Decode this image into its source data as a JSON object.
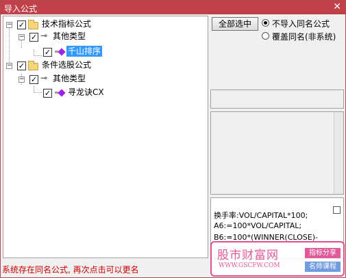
{
  "window": {
    "title": "导入公式",
    "close_glyph": "✕"
  },
  "tree": {
    "groups": [
      {
        "label": "技术指标公式",
        "expander": "−",
        "checked": true,
        "children": [
          {
            "label": "其他类型",
            "expander": "−",
            "checked": true,
            "items": [
              {
                "label": "千山排序",
                "checked": true,
                "selected": true
              }
            ]
          }
        ]
      },
      {
        "label": "条件选股公式",
        "expander": "−",
        "checked": true,
        "children": [
          {
            "label": "其他类型",
            "expander": "−",
            "checked": true,
            "items": [
              {
                "label": "寻龙诀CX",
                "checked": true,
                "selected": false
              }
            ]
          }
        ]
      }
    ],
    "check_glyph": "✓",
    "key_glyph": "⊸"
  },
  "controls": {
    "select_all_label": "全部选中",
    "radio_skip_label": "不导入同名公式",
    "radio_overwrite_label": "覆盖同名(非系统)",
    "selected_radio": "skip"
  },
  "code": {
    "lines": [
      "换手率:VOL/CAPITAL*100;",
      "A6:=100*VOL/CAPITAL;",
      "B6:=100*(WINNER(CLOSE)-"
    ]
  },
  "status": {
    "message": "系统存在同名公式, 再次点击可以更名"
  },
  "watermark": {
    "name": "股市财富网",
    "url": "WWW.GSCFW.COM",
    "tag1": "指标分享",
    "tag2": "名师课程",
    "color": "#e05a9a"
  }
}
